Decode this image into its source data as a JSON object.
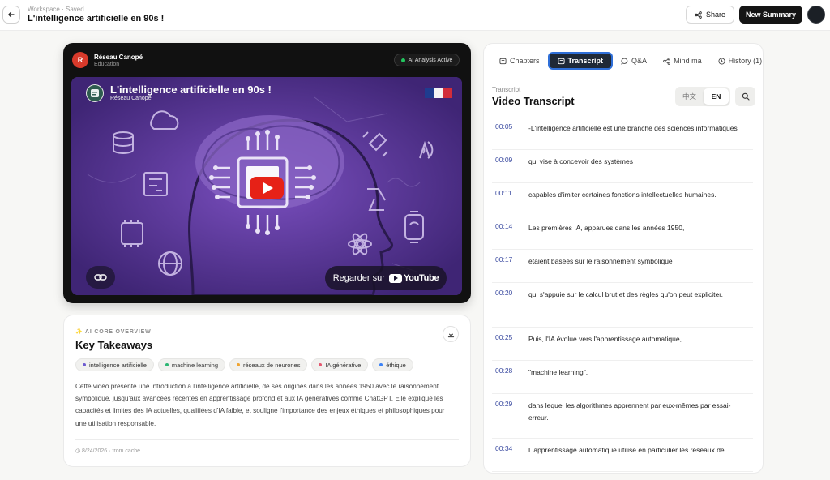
{
  "header": {
    "crumb": "Workspace · Saved",
    "title": "L'intelligence artificielle en 90s !",
    "share_label": "Share",
    "new_summary_label": "New Summary"
  },
  "video": {
    "channel_initial": "R",
    "channel_name": "Réseau Canopé",
    "channel_category": "Education",
    "ai_badge": "AI Analysis Active",
    "title": "L'intelligence artificielle en 90s !",
    "channel": "Réseau Canopé",
    "watch_on": "Regarder sur",
    "youtube_word": "YouTube"
  },
  "summary": {
    "label": "✨ AI CORE OVERVIEW",
    "title": "Key Takeaways",
    "tags": [
      {
        "label": "intelligence artificielle",
        "color": "#6d5bd0"
      },
      {
        "label": "machine learning",
        "color": "#2bb673"
      },
      {
        "label": "réseaux de neurones",
        "color": "#f0a431"
      },
      {
        "label": "IA générative",
        "color": "#e5566e"
      },
      {
        "label": "éthique",
        "color": "#3b82f6"
      }
    ],
    "text": "Cette vidéo présente une introduction à l'intelligence artificielle, de ses origines dans les années 1950 avec le raisonnement symbolique, jusqu'aux avancées récentes en apprentissage profond et aux IA génératives comme ChatGPT. Elle explique les capacités et limites des IA actuelles, qualifiées d'IA faible, et souligne l'importance des enjeux éthiques et philosophiques pour une utilisation responsable.",
    "cache": "◷ 8/24/2026 · from cache"
  },
  "panel": {
    "tabs": [
      {
        "label": "Chapters",
        "icon": "list-icon"
      },
      {
        "label": "Transcript",
        "icon": "transcript-icon"
      },
      {
        "label": "Q&A",
        "icon": "chat-icon"
      },
      {
        "label": "Mind ma",
        "icon": "mindmap-icon"
      },
      {
        "label": "History (1)",
        "icon": "clock-icon"
      }
    ],
    "transcript_label": "Transcript",
    "transcript_title": "Video Transcript",
    "lang_zh": "中文",
    "lang_en": "EN",
    "rows": [
      {
        "time": "00:05",
        "text": "-L'intelligence artificielle est une branche des sciences informatiques"
      },
      {
        "time": "00:09",
        "text": "qui vise à concevoir des systèmes"
      },
      {
        "time": "00:11",
        "text": "capables d'imiter certaines fonctions intellectuelles humaines."
      },
      {
        "time": "00:14",
        "text": "Les premières IA, apparues dans les années 1950,"
      },
      {
        "time": "00:17",
        "text": "étaient basées sur le raisonnement symbolique"
      },
      {
        "time": "00:20",
        "text": "qui s'appuie sur le calcul brut et des règles qu'on peut expliciter."
      },
      {
        "time": "00:25",
        "text": "Puis, l'IA évolue vers l'apprentissage automatique,"
      },
      {
        "time": "00:28",
        "text": "\"machine learning\","
      },
      {
        "time": "00:29",
        "text": "dans lequel les algorithmes apprennent par eux-mêmes par essai-erreur."
      },
      {
        "time": "00:34",
        "text": "L'apprentissage automatique utilise en particulier les réseaux de"
      }
    ]
  }
}
